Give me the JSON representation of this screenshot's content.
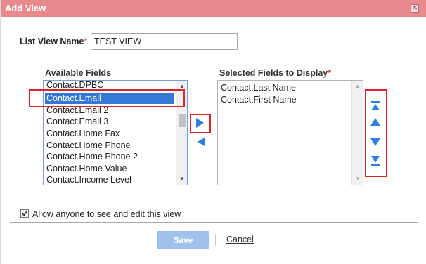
{
  "dialog": {
    "title": "Add View",
    "close_glyph": "✕",
    "title_bar_color": "#e8898d"
  },
  "form": {
    "list_view_name_label": "List View Name",
    "required_marker": "*",
    "list_view_name_value": "TEST VIEW"
  },
  "available": {
    "label": "Available Fields",
    "items": [
      "Contact.DPBC",
      "Contact.Email",
      "Contact.Email 2",
      "Contact.Email 3",
      "Contact.Home Fax",
      "Contact.Home Phone",
      "Contact.Home Phone 2",
      "Contact.Home Value",
      "Contact.Income Level"
    ],
    "selected_item": "Contact.Email"
  },
  "selected": {
    "label": "Selected Fields to Display",
    "items": [
      "Contact.Last Name",
      "Contact.First Name"
    ]
  },
  "move_buttons": {
    "right_icon": "arrow-right-icon",
    "left_icon": "arrow-left-icon"
  },
  "order_buttons": [
    "move-top-icon",
    "move-up-icon",
    "move-down-icon",
    "move-bottom-icon"
  ],
  "options": {
    "allow_edit_label": "Allow anyone to see and edit this view",
    "allow_edit_checked": true
  },
  "actions": {
    "save": "Save",
    "cancel": "Cancel"
  },
  "colors": {
    "accent_blue": "#2f7fe0",
    "highlight_red": "#d9252b",
    "save_button": "#9fc2ec"
  }
}
